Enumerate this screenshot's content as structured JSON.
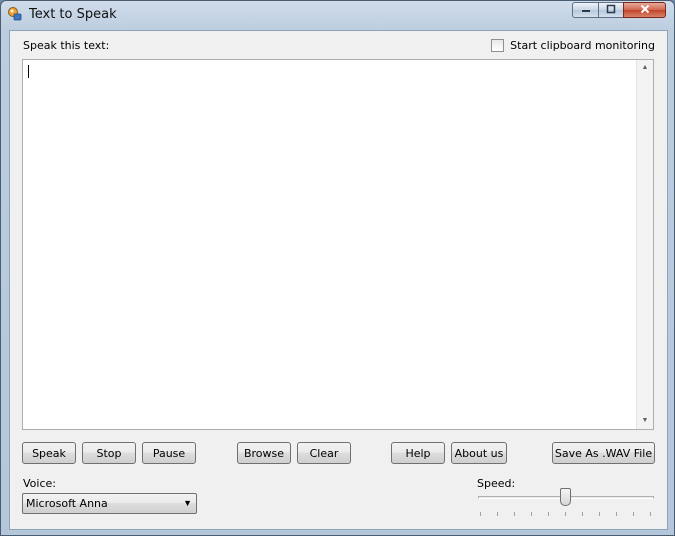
{
  "window": {
    "title": "Text to Speak",
    "icon": "speaker-app-icon",
    "caption": {
      "minimize": "minimize-icon",
      "maximize": "maximize-icon",
      "close": "close-icon"
    }
  },
  "main": {
    "text_label": "Speak this text:",
    "text_value": "",
    "clipboard_checkbox": {
      "label": "Start clipboard monitoring",
      "checked": false
    }
  },
  "buttons": {
    "speak": "Speak",
    "stop": "Stop",
    "pause": "Pause",
    "browse": "Browse",
    "clear": "Clear",
    "help": "Help",
    "about": "About us",
    "save_wav": "Save As .WAV File"
  },
  "voice": {
    "label": "Voice:",
    "selected": "Microsoft Anna"
  },
  "speed": {
    "label": "Speed:",
    "value": 5,
    "min": 0,
    "max": 10
  },
  "colors": {
    "close_button": "#c2432a",
    "frame": "#b3c6da"
  }
}
